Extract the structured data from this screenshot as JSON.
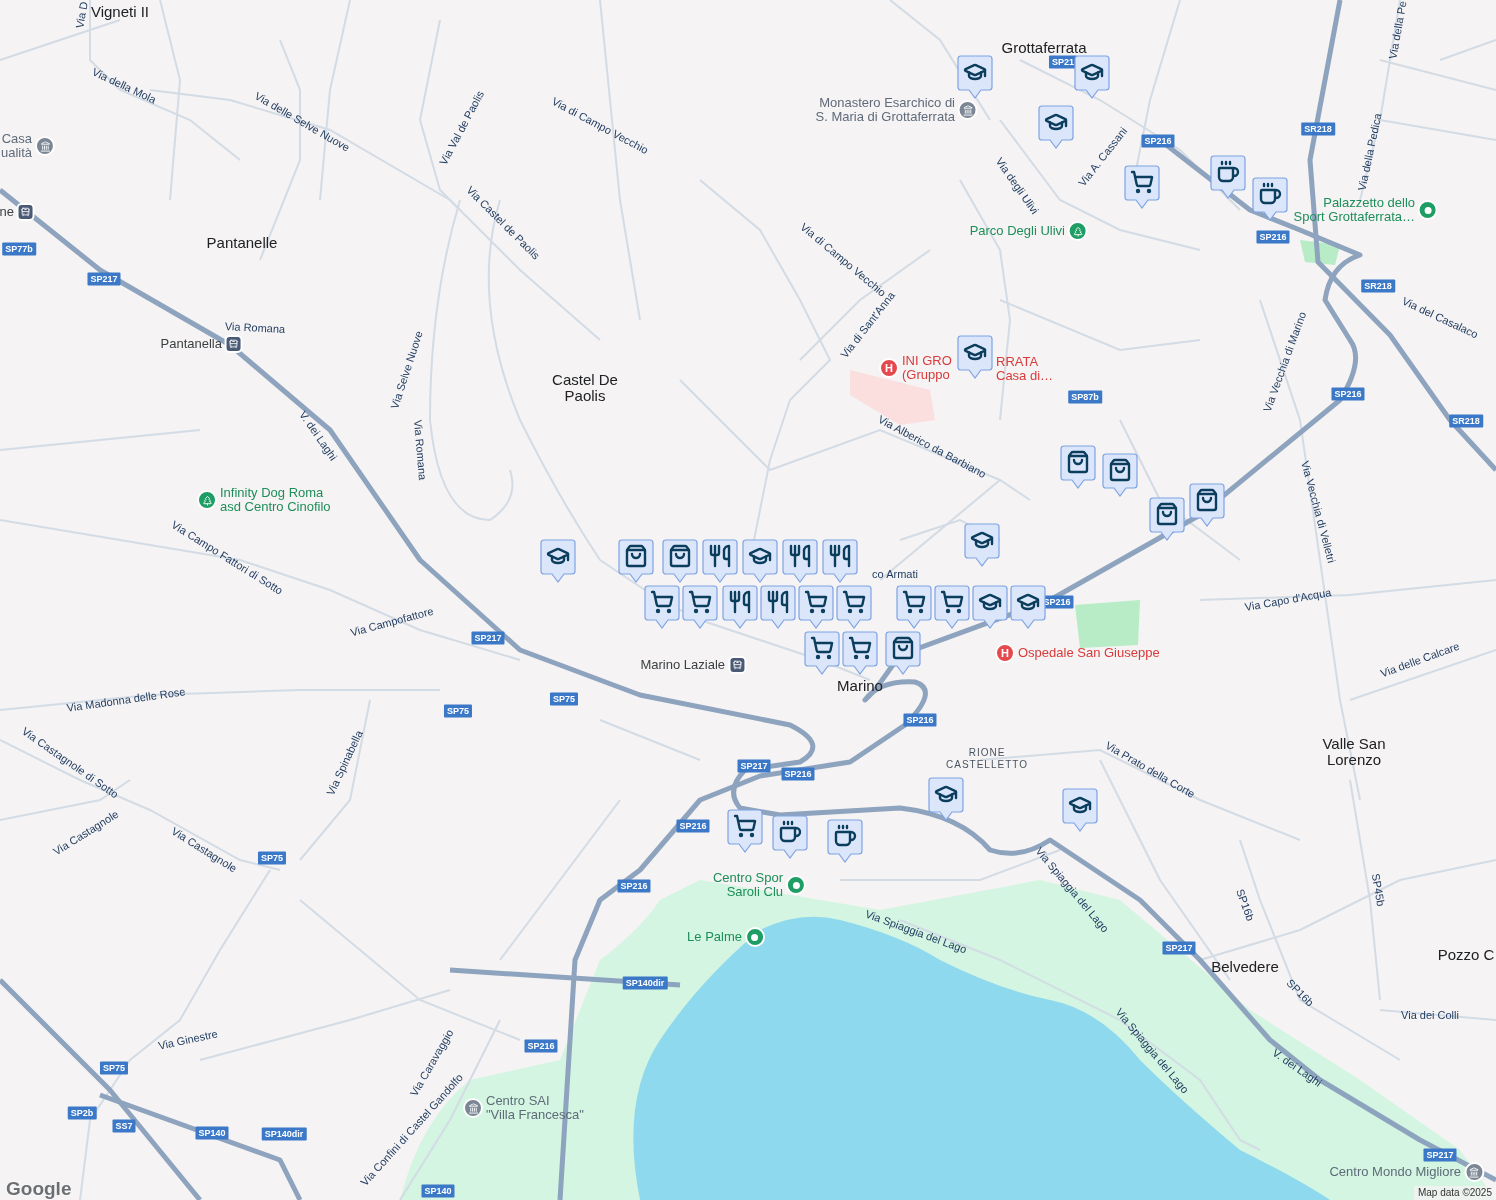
{
  "map": {
    "places": [
      {
        "name": "Vigneti II",
        "kind": "town"
      },
      {
        "name": "Grottaferrata",
        "kind": "town"
      },
      {
        "name": "Pantanelle",
        "kind": "town"
      },
      {
        "name": "Castel De\nPaolis",
        "kind": "town"
      },
      {
        "name": "Marino",
        "kind": "town"
      },
      {
        "name": "Valle San\nLorenzo",
        "kind": "town"
      },
      {
        "name": "Belvedere",
        "kind": "town"
      },
      {
        "name": "Pozzo C",
        "kind": "town"
      },
      {
        "name": "RIONE\nCASTELLETTO",
        "kind": "district"
      }
    ],
    "pois": [
      {
        "lines": [
          "Casa",
          "ualità"
        ],
        "kind": "museum"
      },
      {
        "lines": [
          "ne"
        ],
        "kind": "station"
      },
      {
        "lines": [
          "Monastero Esarchico di",
          "S. Maria di Grottaferrata"
        ],
        "kind": "museum"
      },
      {
        "lines": [
          "Parco Degli Ulivi"
        ],
        "kind": "park"
      },
      {
        "lines": [
          "Palazzetto dello",
          "Sport Grottaferrata…"
        ],
        "kind": "sport"
      },
      {
        "lines": [
          "Pantanella"
        ],
        "kind": "station"
      },
      {
        "lines": [
          "INI GRO",
          "(Gruppo"
        ],
        "kind": "hospital",
        "icon_glyph": "H"
      },
      {
        "lines": [
          "RRATA",
          "Casa di…"
        ],
        "kind": "hospital_text"
      },
      {
        "lines": [
          "Infinity Dog Roma",
          "asd Centro Cinofilo"
        ],
        "kind": "park"
      },
      {
        "lines": [
          "Marino Laziale"
        ],
        "kind": "station"
      },
      {
        "lines": [
          "Ospedale San Giuseppe"
        ],
        "kind": "hospital",
        "icon_glyph": "H"
      },
      {
        "lines": [
          "Centro Spor",
          "Saroli Clu"
        ],
        "kind": "sport"
      },
      {
        "lines": [
          "Le Palme"
        ],
        "kind": "sport"
      },
      {
        "lines": [
          "Centro SAI",
          "\"Villa Francesca\""
        ],
        "kind": "museum"
      },
      {
        "lines": [
          "Centro Mondo Migliore"
        ],
        "kind": "museum"
      }
    ],
    "streets": [
      {
        "text": "Via D"
      },
      {
        "text": "Via della Mola"
      },
      {
        "text": "Via delle Selve Nuove"
      },
      {
        "text": "Via Val de Paolis"
      },
      {
        "text": "Via di Campo Vecchio"
      },
      {
        "text": "Via Castel de Paolis"
      },
      {
        "text": "Via di Campo Vecchio"
      },
      {
        "text": "Via di Sant'Anna"
      },
      {
        "text": "Via degli Ulivi"
      },
      {
        "text": "Via A. Cassani"
      },
      {
        "text": "Via della Pe"
      },
      {
        "text": "Via della Pedica"
      },
      {
        "text": "Via Romana"
      },
      {
        "text": "Via Selve Nuove"
      },
      {
        "text": "Via Romana"
      },
      {
        "text": "V. dei Laghi"
      },
      {
        "text": "Via Alberico da Barbiano"
      },
      {
        "text": "Via Vecchia di Marino"
      },
      {
        "text": "Via del Casalaco"
      },
      {
        "text": "Via Vecchia di Velletri"
      },
      {
        "text": "Via Capo d'Acqua"
      },
      {
        "text": "Via delle Calcare"
      },
      {
        "text": "Via Campo Fattori di Sotto"
      },
      {
        "text": "Via Campofattore"
      },
      {
        "text": "Via Madonna delle Rose"
      },
      {
        "text": "Via Castagnole di Sotto"
      },
      {
        "text": "Via Spinabella"
      },
      {
        "text": "Via Castagnole"
      },
      {
        "text": "Via Castagnole"
      },
      {
        "text": "Via Prato della Corte"
      },
      {
        "text": "Via Spiaggia del Lago"
      },
      {
        "text": "Via Spiaggia del Lago"
      },
      {
        "text": "Via Spiaggia del Lago"
      },
      {
        "text": "SP16b"
      },
      {
        "text": "SP16b"
      },
      {
        "text": "SP45b"
      },
      {
        "text": "V. dei Laghi"
      },
      {
        "text": "Via dei Colli"
      },
      {
        "text": "Via Ginestre"
      },
      {
        "text": "Via Caravaggio"
      },
      {
        "text": "Via Confini di Castel Gandolfo"
      },
      {
        "text": "co Armati"
      }
    ],
    "route_shields": [
      "SP77b",
      "SP217",
      "SP217",
      "SP75",
      "SP75",
      "SP75",
      "SP217",
      "SP216",
      "SP216",
      "SP216",
      "SP216",
      "SP216",
      "SP216",
      "SP140dir",
      "SP75",
      "SP2b",
      "SS7",
      "SP140",
      "SP140dir",
      "SP140",
      "SP217",
      "SP217",
      "SP216",
      "SP216",
      "SP216",
      "SR218",
      "SR218",
      "SR218",
      "SP87b",
      "SP21"
    ],
    "markers": [
      {
        "kind": "school"
      },
      {
        "kind": "school"
      },
      {
        "kind": "school"
      },
      {
        "kind": "grocery"
      },
      {
        "kind": "cafe"
      },
      {
        "kind": "cafe"
      },
      {
        "kind": "school"
      },
      {
        "kind": "shopping"
      },
      {
        "kind": "shopping"
      },
      {
        "kind": "shopping"
      },
      {
        "kind": "school"
      },
      {
        "kind": "school"
      },
      {
        "kind": "shopping"
      },
      {
        "kind": "shopping"
      },
      {
        "kind": "restaurant"
      },
      {
        "kind": "school"
      },
      {
        "kind": "restaurant"
      },
      {
        "kind": "restaurant"
      },
      {
        "kind": "grocery"
      },
      {
        "kind": "grocery"
      },
      {
        "kind": "restaurant"
      },
      {
        "kind": "restaurant"
      },
      {
        "kind": "grocery"
      },
      {
        "kind": "grocery"
      },
      {
        "kind": "shopping"
      },
      {
        "kind": "grocery"
      },
      {
        "kind": "grocery"
      },
      {
        "kind": "grocery"
      },
      {
        "kind": "grocery"
      },
      {
        "kind": "school"
      },
      {
        "kind": "school"
      },
      {
        "kind": "shopping"
      },
      {
        "kind": "school"
      },
      {
        "kind": "school"
      },
      {
        "kind": "grocery"
      },
      {
        "kind": "cafe"
      },
      {
        "kind": "cafe"
      }
    ]
  },
  "logo": "Google",
  "attribution": "Map data ©2025"
}
